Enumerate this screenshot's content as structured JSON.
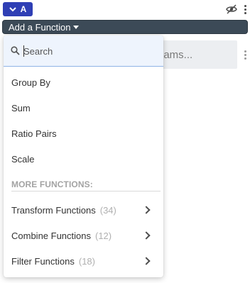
{
  "query": {
    "label": "A"
  },
  "toolbar": {
    "add_function_label": "Add a Function"
  },
  "streams": {
    "placeholder": "eams..."
  },
  "dropdown": {
    "search_placeholder": "Search",
    "items": [
      {
        "label": "Group By"
      },
      {
        "label": "Sum"
      },
      {
        "label": "Ratio Pairs"
      },
      {
        "label": "Scale"
      }
    ],
    "more_heading": "MORE FUNCTIONS:",
    "submenus": [
      {
        "label": "Transform Functions",
        "count": "(34)"
      },
      {
        "label": "Combine Functions",
        "count": "(12)"
      },
      {
        "label": "Filter Functions",
        "count": "(18)"
      }
    ]
  },
  "colors": {
    "query_chip": "#2f3fb5",
    "toolbar_bg": "#3c4a57",
    "search_bg": "#eef4fd"
  }
}
